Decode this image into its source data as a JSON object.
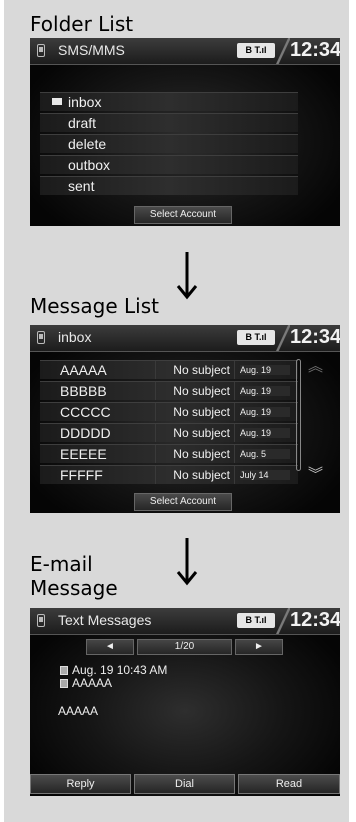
{
  "sections": {
    "folder": "Folder List",
    "message": "Message List",
    "email_line1": "E-mail",
    "email_line2": "Message"
  },
  "status_badge": "B T.ıl",
  "clock": "12:34",
  "folder_screen": {
    "title": "SMS/MMS",
    "items": [
      "inbox",
      "draft",
      "delete",
      "outbox",
      "sent"
    ],
    "select_account": "Select Account"
  },
  "message_screen": {
    "title": "inbox",
    "messages": [
      {
        "name": "AAAAA",
        "subject": "No subject",
        "date": "Aug. 19"
      },
      {
        "name": "BBBBB",
        "subject": "No subject",
        "date": "Aug. 19"
      },
      {
        "name": "CCCCC",
        "subject": "No subject",
        "date": "Aug. 19"
      },
      {
        "name": "DDDDD",
        "subject": "No subject",
        "date": "Aug. 19"
      },
      {
        "name": "EEEEE",
        "subject": "No subject",
        "date": "Aug. 5"
      },
      {
        "name": "FFFFF",
        "subject": "No subject",
        "date": "July 14"
      }
    ],
    "select_account": "Select Account"
  },
  "text_screen": {
    "title": "Text Messages",
    "page": "1/20",
    "prev": "◄",
    "next": "►",
    "datetime": "Aug. 19 10:43 AM",
    "sender": "AAAAA",
    "body": "AAAAA",
    "buttons": [
      "Reply",
      "Dial",
      "Read"
    ]
  }
}
